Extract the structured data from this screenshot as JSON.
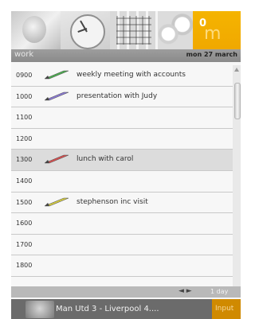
{
  "tabs": [
    {
      "icon": "baby-photo-icon"
    },
    {
      "icon": "clock-icon"
    },
    {
      "icon": "calendar-photo-icon"
    },
    {
      "icon": "bubbles-icon"
    },
    {
      "icon": "active-tab-icon",
      "text": "0"
    }
  ],
  "header": {
    "title": "work",
    "date": "mon 27 march"
  },
  "schedule": [
    {
      "time": "0900",
      "label": "weekly meeting with accounts",
      "marker": "green-pencil-icon",
      "marker_color": "#4caf50"
    },
    {
      "time": "1000",
      "label": "presentation with Judy",
      "marker": "purple-pencil-icon",
      "marker_color": "#8b7ad6"
    },
    {
      "time": "1100",
      "label": "",
      "marker": ""
    },
    {
      "time": "1200",
      "label": "",
      "marker": ""
    },
    {
      "time": "1300",
      "label": "lunch with carol",
      "marker": "red-pencil-icon",
      "marker_color": "#d85050",
      "selected": true
    },
    {
      "time": "1400",
      "label": "",
      "marker": ""
    },
    {
      "time": "1500",
      "label": "stephenson inc visit",
      "marker": "yellow-pencil-icon",
      "marker_color": "#d8cf40"
    },
    {
      "time": "1600",
      "label": "",
      "marker": ""
    },
    {
      "time": "1700",
      "label": "",
      "marker": ""
    },
    {
      "time": "1800",
      "label": "",
      "marker": ""
    }
  ],
  "footer": {
    "nav": "◄ ►",
    "range": "1 day"
  },
  "ticker": {
    "text": "Man Utd 3 - Liverpool 4....",
    "side": "Input"
  }
}
